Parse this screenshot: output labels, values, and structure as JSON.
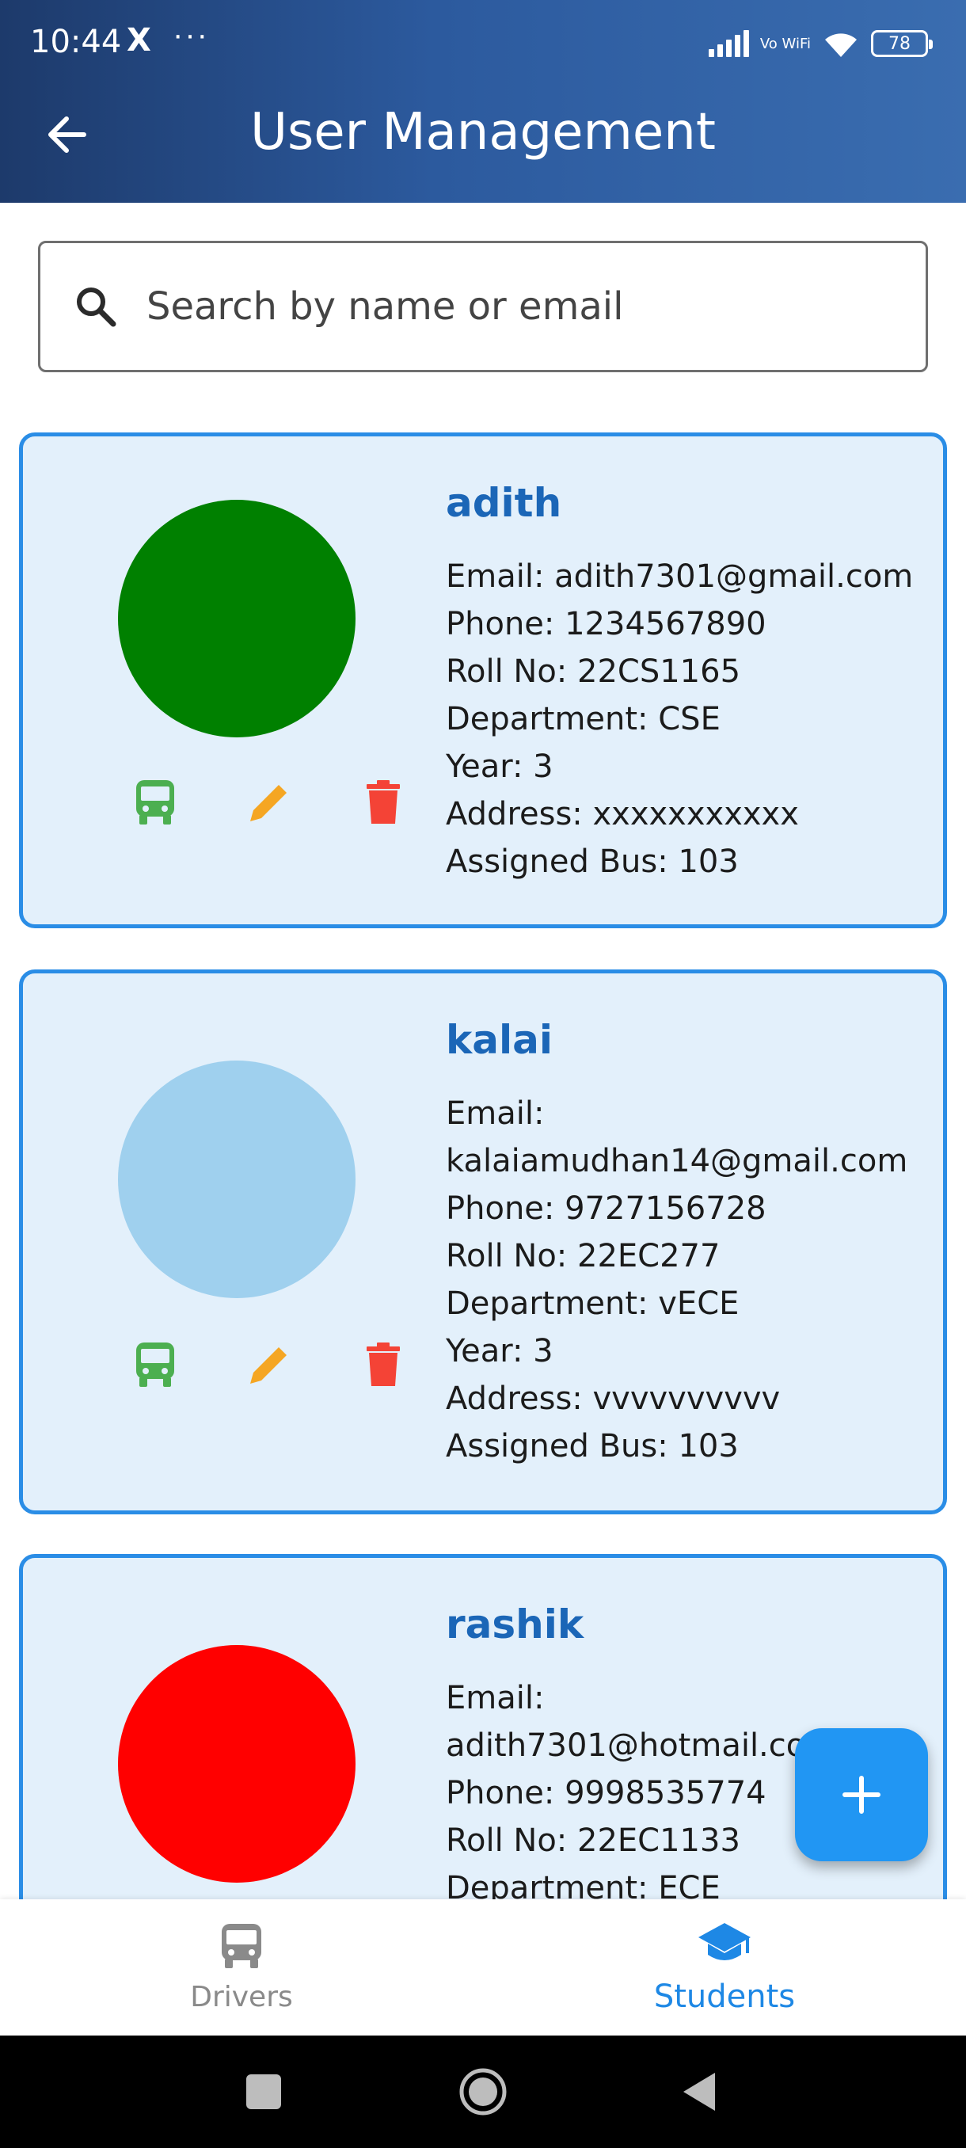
{
  "status_bar": {
    "time": "10:44",
    "x_icon": "X",
    "dots": "···",
    "network": "Vo WiFi",
    "battery": "78"
  },
  "app_bar": {
    "title": "User Management",
    "back_icon": "arrow-left-icon"
  },
  "search": {
    "placeholder": "Search by name or email",
    "value": ""
  },
  "students": [
    {
      "name": "adith",
      "avatar_color": "#008000",
      "email_label": "Email: adith7301@gmail.com",
      "phone": "Phone: 1234567890",
      "roll": "Roll No: 22CS1165",
      "department": "Department: CSE",
      "year": "Year: 3",
      "address": "Address: xxxxxxxxxxx",
      "bus": "Assigned Bus: 103"
    },
    {
      "name": "kalai",
      "avatar_color": "#9fd0ee",
      "email_label": "Email:",
      "email_value": "kalaiamudhan14@gmail.com",
      "phone": "Phone: 9727156728",
      "roll": "Roll No: 22EC277",
      "department": "Department: vECE",
      "year": "Year: 3",
      "address": "Address: vvvvvvvvvv",
      "bus": "Assigned Bus: 103"
    },
    {
      "name": "rashik",
      "avatar_color": "#ff0000",
      "email_label": "Email:",
      "email_value": "adith7301@hotmail.com",
      "phone": "Phone: 9998535774",
      "roll": "Roll No: 22EC1133",
      "department": "Department: ECE"
    }
  ],
  "colors": {
    "accent": "#2196f3",
    "name_text": "#1b66b7",
    "card_bg": "#e3f0fb",
    "card_border": "#2a8de6",
    "bus_icon": "#4caf50",
    "edit_icon": "#f5a623",
    "delete_icon": "#f44336"
  },
  "bottom_nav": {
    "items": [
      {
        "label": "Drivers",
        "icon": "bus-icon",
        "active": false
      },
      {
        "label": "Students",
        "icon": "school-icon",
        "active": true
      }
    ]
  },
  "fab": {
    "icon": "plus-icon"
  }
}
